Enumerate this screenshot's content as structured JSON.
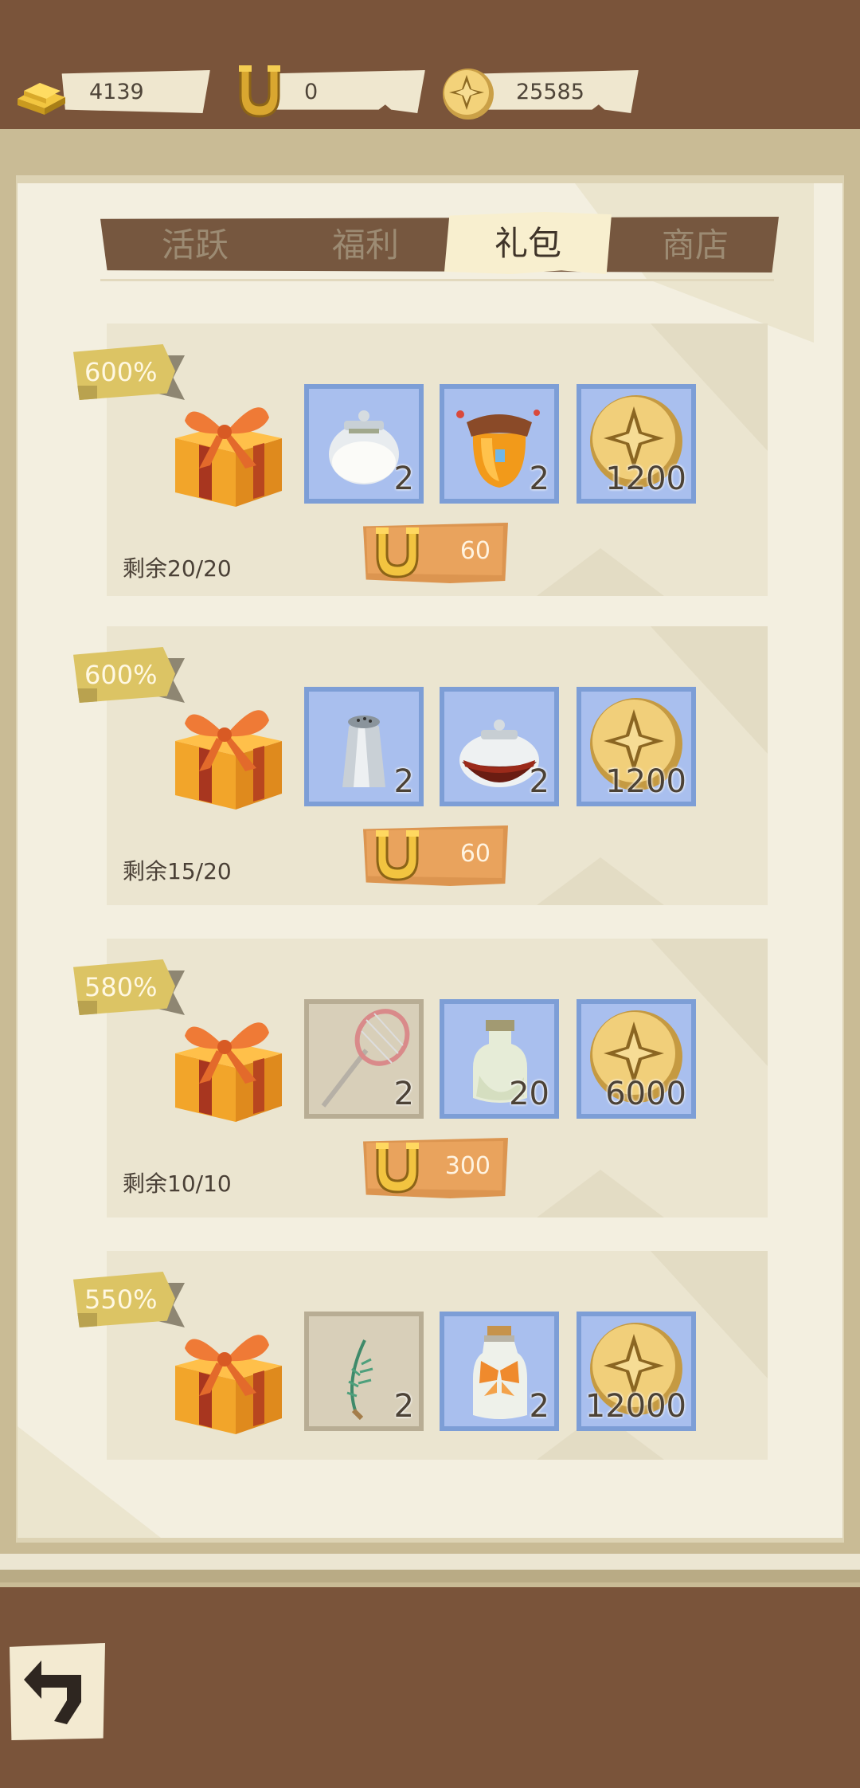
{
  "resources": [
    {
      "name": "gold",
      "icon": "gold-bar-icon",
      "value": "4139"
    },
    {
      "name": "horseshoe",
      "icon": "horseshoe-icon",
      "value": "0"
    },
    {
      "name": "coin",
      "icon": "coin-icon",
      "value": "25585"
    }
  ],
  "tabs": [
    {
      "label": "活跃",
      "active": false
    },
    {
      "label": "福利",
      "active": false
    },
    {
      "label": "礼包",
      "active": true
    },
    {
      "label": "商店",
      "active": false
    }
  ],
  "packs": [
    {
      "badge": "600%",
      "items": [
        {
          "icon": "sugar-jar-icon",
          "count": "2"
        },
        {
          "icon": "honey-jar-icon",
          "count": "2"
        },
        {
          "icon": "coin-icon",
          "count": "1200"
        }
      ],
      "price": "60",
      "remaining": "剩余20/20"
    },
    {
      "badge": "600%",
      "items": [
        {
          "icon": "salt-shaker-icon",
          "count": "2"
        },
        {
          "icon": "sauce-jar-icon",
          "count": "2"
        },
        {
          "icon": "coin-icon",
          "count": "1200"
        }
      ],
      "price": "60",
      "remaining": "剩余15/20"
    },
    {
      "badge": "580%",
      "items": [
        {
          "icon": "butterfly-net-icon",
          "count": "2"
        },
        {
          "icon": "glass-bottle-icon",
          "count": "20"
        },
        {
          "icon": "coin-icon",
          "count": "6000"
        }
      ],
      "price": "300",
      "remaining": "剩余10/10"
    },
    {
      "badge": "550%",
      "items": [
        {
          "icon": "herb-sprig-icon",
          "count": "2"
        },
        {
          "icon": "butterfly-bottle-icon",
          "count": "2"
        },
        {
          "icon": "coin-icon",
          "count": "12000"
        }
      ]
    }
  ],
  "colors": {
    "wood": "#7a543a",
    "paper": "#f3efe0",
    "slot_blue": "#a9bfee",
    "price_orange": "#dc9550",
    "badge_gold": "#dcc464"
  }
}
